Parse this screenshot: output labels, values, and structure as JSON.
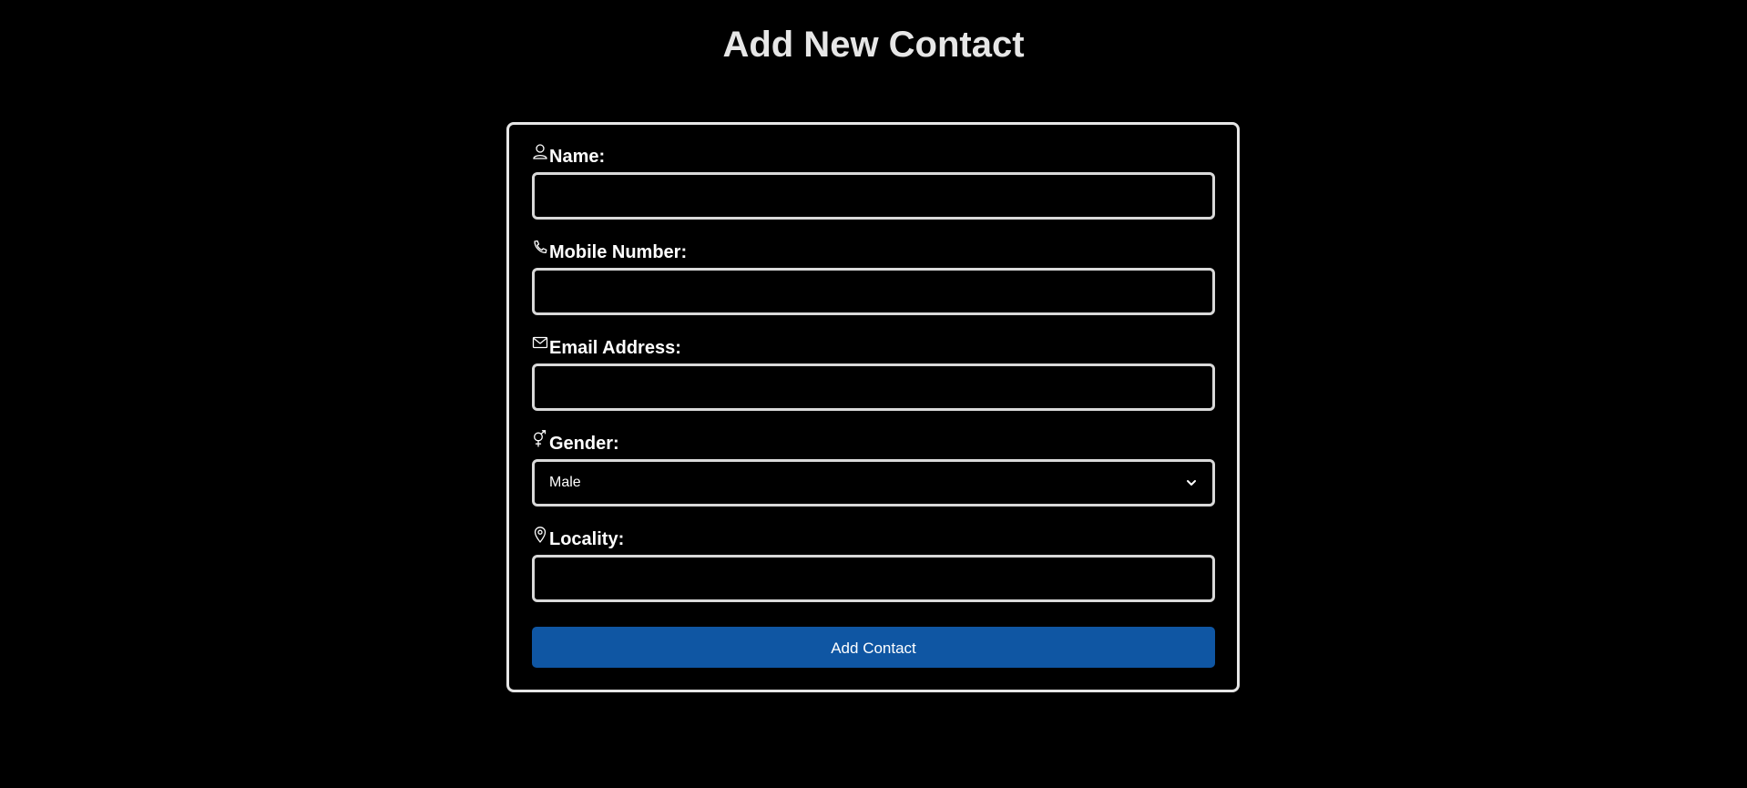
{
  "page": {
    "title": "Add New Contact"
  },
  "form": {
    "fields": [
      {
        "label": "Name:",
        "icon": "person-icon",
        "type": "text",
        "value": "",
        "placeholder": ""
      },
      {
        "label": "Mobile Number:",
        "icon": "phone-icon",
        "type": "tel",
        "value": "",
        "placeholder": ""
      },
      {
        "label": "Email Address:",
        "icon": "envelope-icon",
        "type": "email",
        "value": "",
        "placeholder": ""
      },
      {
        "label": "Gender:",
        "icon": "gender-icon",
        "type": "select",
        "value": "Male"
      },
      {
        "label": "Locality:",
        "icon": "location-pin-icon",
        "type": "text",
        "value": "",
        "placeholder": ""
      }
    ],
    "submit_label": "Add Contact"
  },
  "colors": {
    "background": "#000000",
    "title_text": "#e6e6e6",
    "border": "#e6e6e6",
    "button_bg": "#0f56a3",
    "button_text": "#ffffff"
  }
}
